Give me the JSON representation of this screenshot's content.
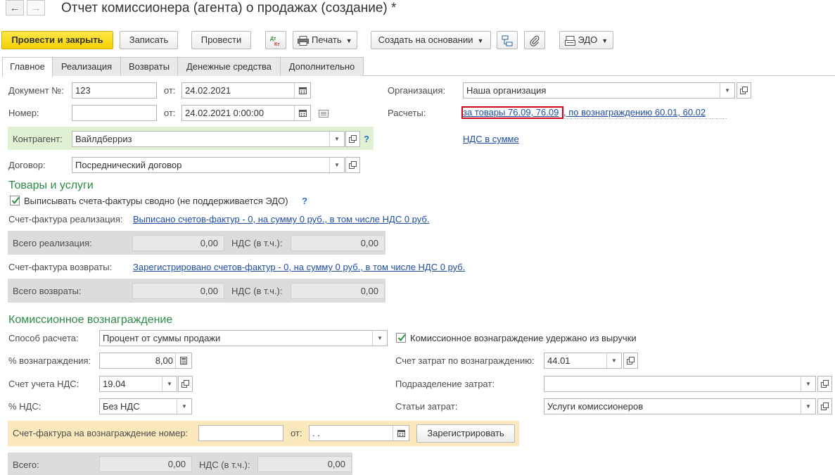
{
  "window": {
    "title": "Отчет комиссионера (агента) о продажах (создание) *"
  },
  "toolbar": {
    "post_close": "Провести и закрыть",
    "save": "Записать",
    "post": "Провести",
    "dtkt": "Дт Кт",
    "print": "Печать",
    "create_based": "Создать на основании",
    "edo": "ЭДО"
  },
  "tabs": [
    "Главное",
    "Реализация",
    "Возвраты",
    "Денежные средства",
    "Дополнительно"
  ],
  "header": {
    "doc_no_label": "Документ №:",
    "doc_no": "123",
    "from_label": "от:",
    "doc_date": "24.02.2021",
    "number_label": "Номер:",
    "number": "",
    "from2_label": "от:",
    "datetime": "24.02.2021  0:00:00",
    "org_label": "Организация:",
    "org": "Наша организация",
    "settlements_label": "Расчеты:",
    "settlements_link_1": "за товары 76.09, 76.09",
    "settlements_link_2": ", по вознаграждению 60.01, 60.02",
    "counterparty_label": "Контрагент:",
    "counterparty": "Вайлдберриз",
    "help_mark": "?",
    "vat_link": "НДС в сумме",
    "contract_label": "Договор:",
    "contract": "Посреднический договор"
  },
  "goods": {
    "section_title": "Товары и услуги",
    "consolidated_label": "Выписывать счета-фактуры сводно (не поддерживается ЭДО)",
    "consolidated_checked": true,
    "help_mark": "?",
    "sales_invoice_label": "Счет-фактура реализация:",
    "sales_invoice_link": "Выписано счетов-фактур - 0, на сумму 0 руб., в том числе НДС 0 руб.",
    "total_sales_label": "Всего реализация:",
    "total_sales": "0,00",
    "vat_incl_label": "НДС (в т.ч.):",
    "total_sales_vat": "0,00",
    "returns_invoice_label": "Счет-фактура возвраты:",
    "returns_invoice_link": "Зарегистрировано счетов-фактур - 0, на сумму 0 руб., в том числе НДС 0 руб.",
    "total_returns_label": "Всего возвраты:",
    "total_returns": "0,00",
    "vat_incl_label_2": "НДС (в т.ч.):",
    "total_returns_vat": "0,00"
  },
  "commission": {
    "section_title": "Комиссионное вознаграждение",
    "method_label": "Способ расчета:",
    "method": "Процент от суммы продажи",
    "withheld_label": "Комиссионное вознаграждение удержано из выручки",
    "withheld_checked": true,
    "percent_label": "% вознаграждения:",
    "percent": "8,00",
    "cost_account_label": "Счет затрат по вознаграждению:",
    "cost_account": "44.01",
    "vat_account_label": "Счет учета НДС:",
    "vat_account": "19.04",
    "cost_dept_label": "Подразделение затрат:",
    "cost_dept": "",
    "vat_rate_label": "% НДС:",
    "vat_rate": "Без НДС",
    "cost_items_label": "Статьи затрат:",
    "cost_items": "Услуги комиссионеров",
    "invoice_no_label": "Счет-фактура на вознаграждение номер:",
    "invoice_no": "",
    "invoice_from_label": "от:",
    "invoice_date": " .  .",
    "register_button": "Зарегистрировать",
    "total_label": "Всего:",
    "total": "0,00",
    "total_vat_label": "НДС (в т.ч.):",
    "total_vat": "0,00"
  },
  "colors": {
    "primary_button": "#f5d000",
    "section_green": "#2e8b46",
    "link_blue": "#1f4ea3",
    "highlight_red": "#d0021b",
    "counterparty_panel": "#dff1d2",
    "invoice_panel": "#fbe9bd"
  }
}
